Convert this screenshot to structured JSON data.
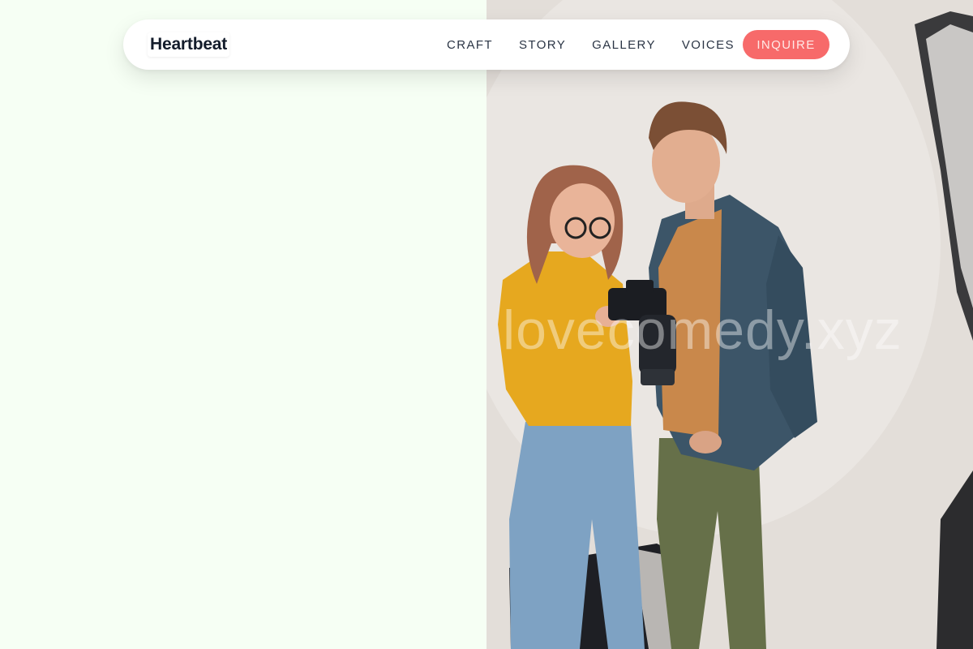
{
  "brand": {
    "name": "Heartbeat"
  },
  "nav": {
    "links": [
      "CRAFT",
      "STORY",
      "GALLERY",
      "VOICES"
    ],
    "cta_label": "INQUIRE"
  },
  "hero": {
    "image_description": "photographer",
    "watermark": "lovecomedy.xyz"
  },
  "colors": {
    "left_background": "#f6fff4",
    "cta": "#f76a6a",
    "brand_text": "#131c2b"
  }
}
